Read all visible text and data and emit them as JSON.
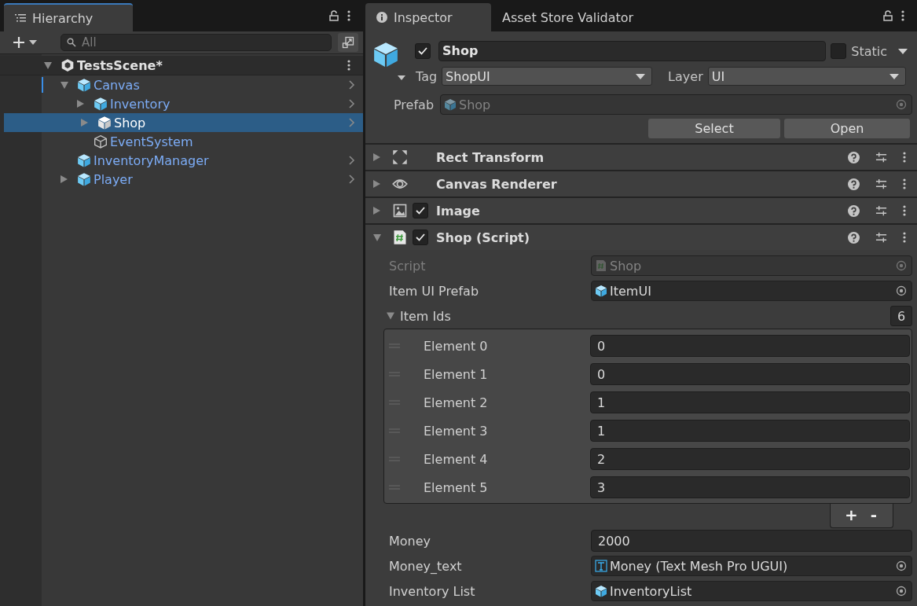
{
  "hierarchy": {
    "tab": {
      "label": "Hierarchy",
      "selected": true
    },
    "search": {
      "placeholder": "All"
    },
    "tree": [
      {
        "label": "TestsScene*",
        "kind": "scene",
        "expanded": true,
        "selected": false,
        "children": [
          {
            "label": "Canvas",
            "kind": "prefab",
            "expanded": true,
            "selected": false,
            "children": [
              {
                "label": "Inventory",
                "kind": "prefab",
                "expanded": false,
                "selected": false
              },
              {
                "label": "Shop",
                "kind": "prefab",
                "expanded": false,
                "selected": true
              },
              {
                "label": "EventSystem",
                "kind": "object",
                "selected": false
              }
            ]
          },
          {
            "label": "InventoryManager",
            "kind": "prefab",
            "selected": false
          },
          {
            "label": "Player",
            "kind": "prefab",
            "expanded": false,
            "selected": false
          }
        ]
      }
    ]
  },
  "inspector": {
    "tabs": [
      {
        "label": "Inspector",
        "selected": true
      },
      {
        "label": "Asset Store Validator",
        "selected": false
      }
    ],
    "object": {
      "active": true,
      "name": "Shop",
      "static": false,
      "static_label": "Static",
      "tag_label": "Tag",
      "tag": "ShopUI",
      "layer_label": "Layer",
      "layer": "UI",
      "prefab_label": "Prefab",
      "prefab": "Shop",
      "buttons": [
        "Select",
        "Open"
      ]
    },
    "components": [
      {
        "title": "Rect Transform",
        "kind": "rect",
        "expanded": false
      },
      {
        "title": "Canvas Renderer",
        "kind": "eye",
        "expanded": false
      },
      {
        "title": "Image",
        "kind": "image",
        "enabled": true,
        "expanded": false
      },
      {
        "title": "Shop (Script)",
        "kind": "script",
        "enabled": true,
        "expanded": true
      }
    ],
    "fields": [
      {
        "label": "Script",
        "kind": "script",
        "value": "Shop",
        "disabled": true
      },
      {
        "label": "Item UI Prefab",
        "kind": "prefab",
        "value": "ItemUI",
        "disabled": false
      },
      {
        "label": "Item Ids",
        "kind": "list",
        "expanded": true,
        "count": "6",
        "elements": [
          {
            "label": "Element 0",
            "value": "0"
          },
          {
            "label": "Element 1",
            "value": "0"
          },
          {
            "label": "Element 2",
            "value": "1"
          },
          {
            "label": "Element 3",
            "value": "1"
          },
          {
            "label": "Element 4",
            "value": "2"
          },
          {
            "label": "Element 5",
            "value": "3"
          }
        ],
        "add": "+",
        "remove": "-"
      },
      {
        "label": "Money",
        "kind": "number",
        "value": "2000",
        "disabled": false
      },
      {
        "label": "Money_text",
        "kind": "text",
        "value": "Money (Text Mesh Pro UGUI)",
        "disabled": false
      },
      {
        "label": "Inventory List",
        "kind": "prefab",
        "value": "InventoryList",
        "disabled": false
      }
    ]
  }
}
